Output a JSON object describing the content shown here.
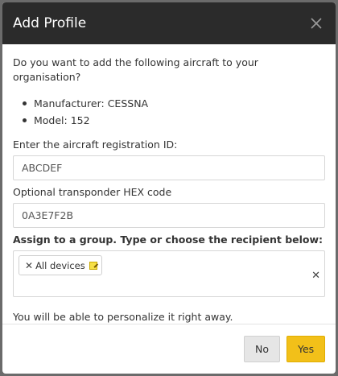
{
  "dialog": {
    "title": "Add Profile",
    "question": "Do you want to add the following aircraft to your organisation?",
    "details": [
      {
        "text": "Manufacturer: CESSNA"
      },
      {
        "text": "Model: 152"
      }
    ],
    "registration_label": "Enter the aircraft registration ID:",
    "registration_value": "ABCDEF",
    "transponder_label": "Optional transponder HEX code",
    "transponder_value": "0A3E7F2B",
    "group_label": "Assign to a group. Type or choose the recipient below:",
    "group_tags": [
      {
        "label": "All devices"
      }
    ],
    "note": "You will be able to personalize it right away.",
    "no_label": "No",
    "yes_label": "Yes"
  },
  "colors": {
    "header_bg": "#2b2b2b",
    "primary_button": "#f2c019",
    "secondary_button": "#e6e6e6"
  },
  "icons": {
    "close": "close-icon",
    "tag_remove": "x-icon",
    "tag_edit": "edit-icon",
    "clear": "clear-icon"
  }
}
